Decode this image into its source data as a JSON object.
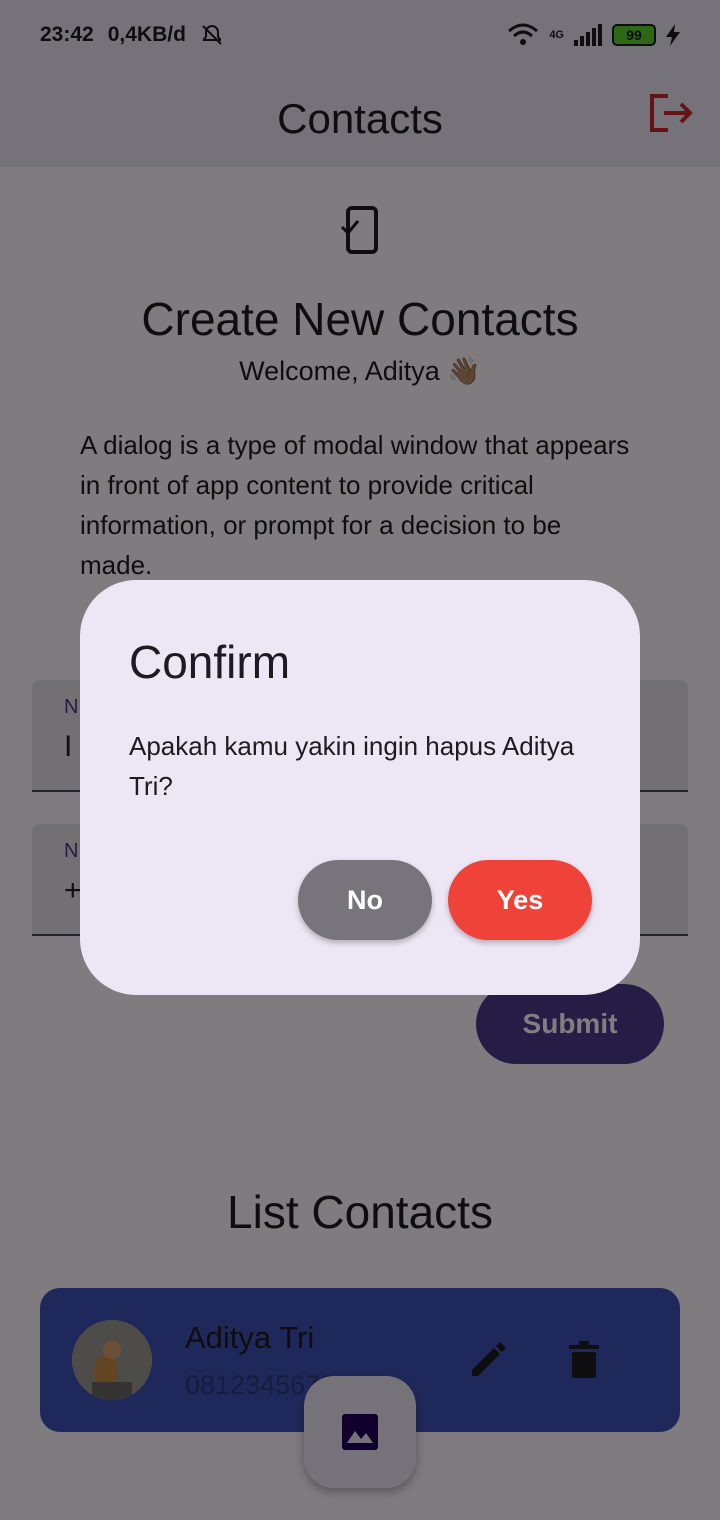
{
  "status_bar": {
    "time": "23:42",
    "net_speed": "0,4KB/d",
    "network_label": "4G",
    "battery": "99"
  },
  "app_bar": {
    "title": "Contacts"
  },
  "form": {
    "heading": "Create New Contacts",
    "welcome": "Welcome, Aditya 👋🏽",
    "description": "A dialog is a type of modal window that appears in front of app content to provide critical information, or prompt for a decision to be made.",
    "name_field": {
      "label": "N",
      "value": "I"
    },
    "phone_field": {
      "label": "N",
      "value": "+"
    },
    "submit_label": "Submit"
  },
  "list": {
    "heading": "List Contacts",
    "contacts": [
      {
        "name": "Aditya Tri",
        "phone": "0812345673"
      }
    ]
  },
  "dialog": {
    "title": "Confirm",
    "message": "Apakah kamu yakin ingin hapus Aditya Tri?",
    "no_label": "No",
    "yes_label": "Yes"
  },
  "colors": {
    "primary": "#4a3a8c",
    "danger": "#ef4238",
    "card": "#3f51b5",
    "logout": "#c62828"
  }
}
